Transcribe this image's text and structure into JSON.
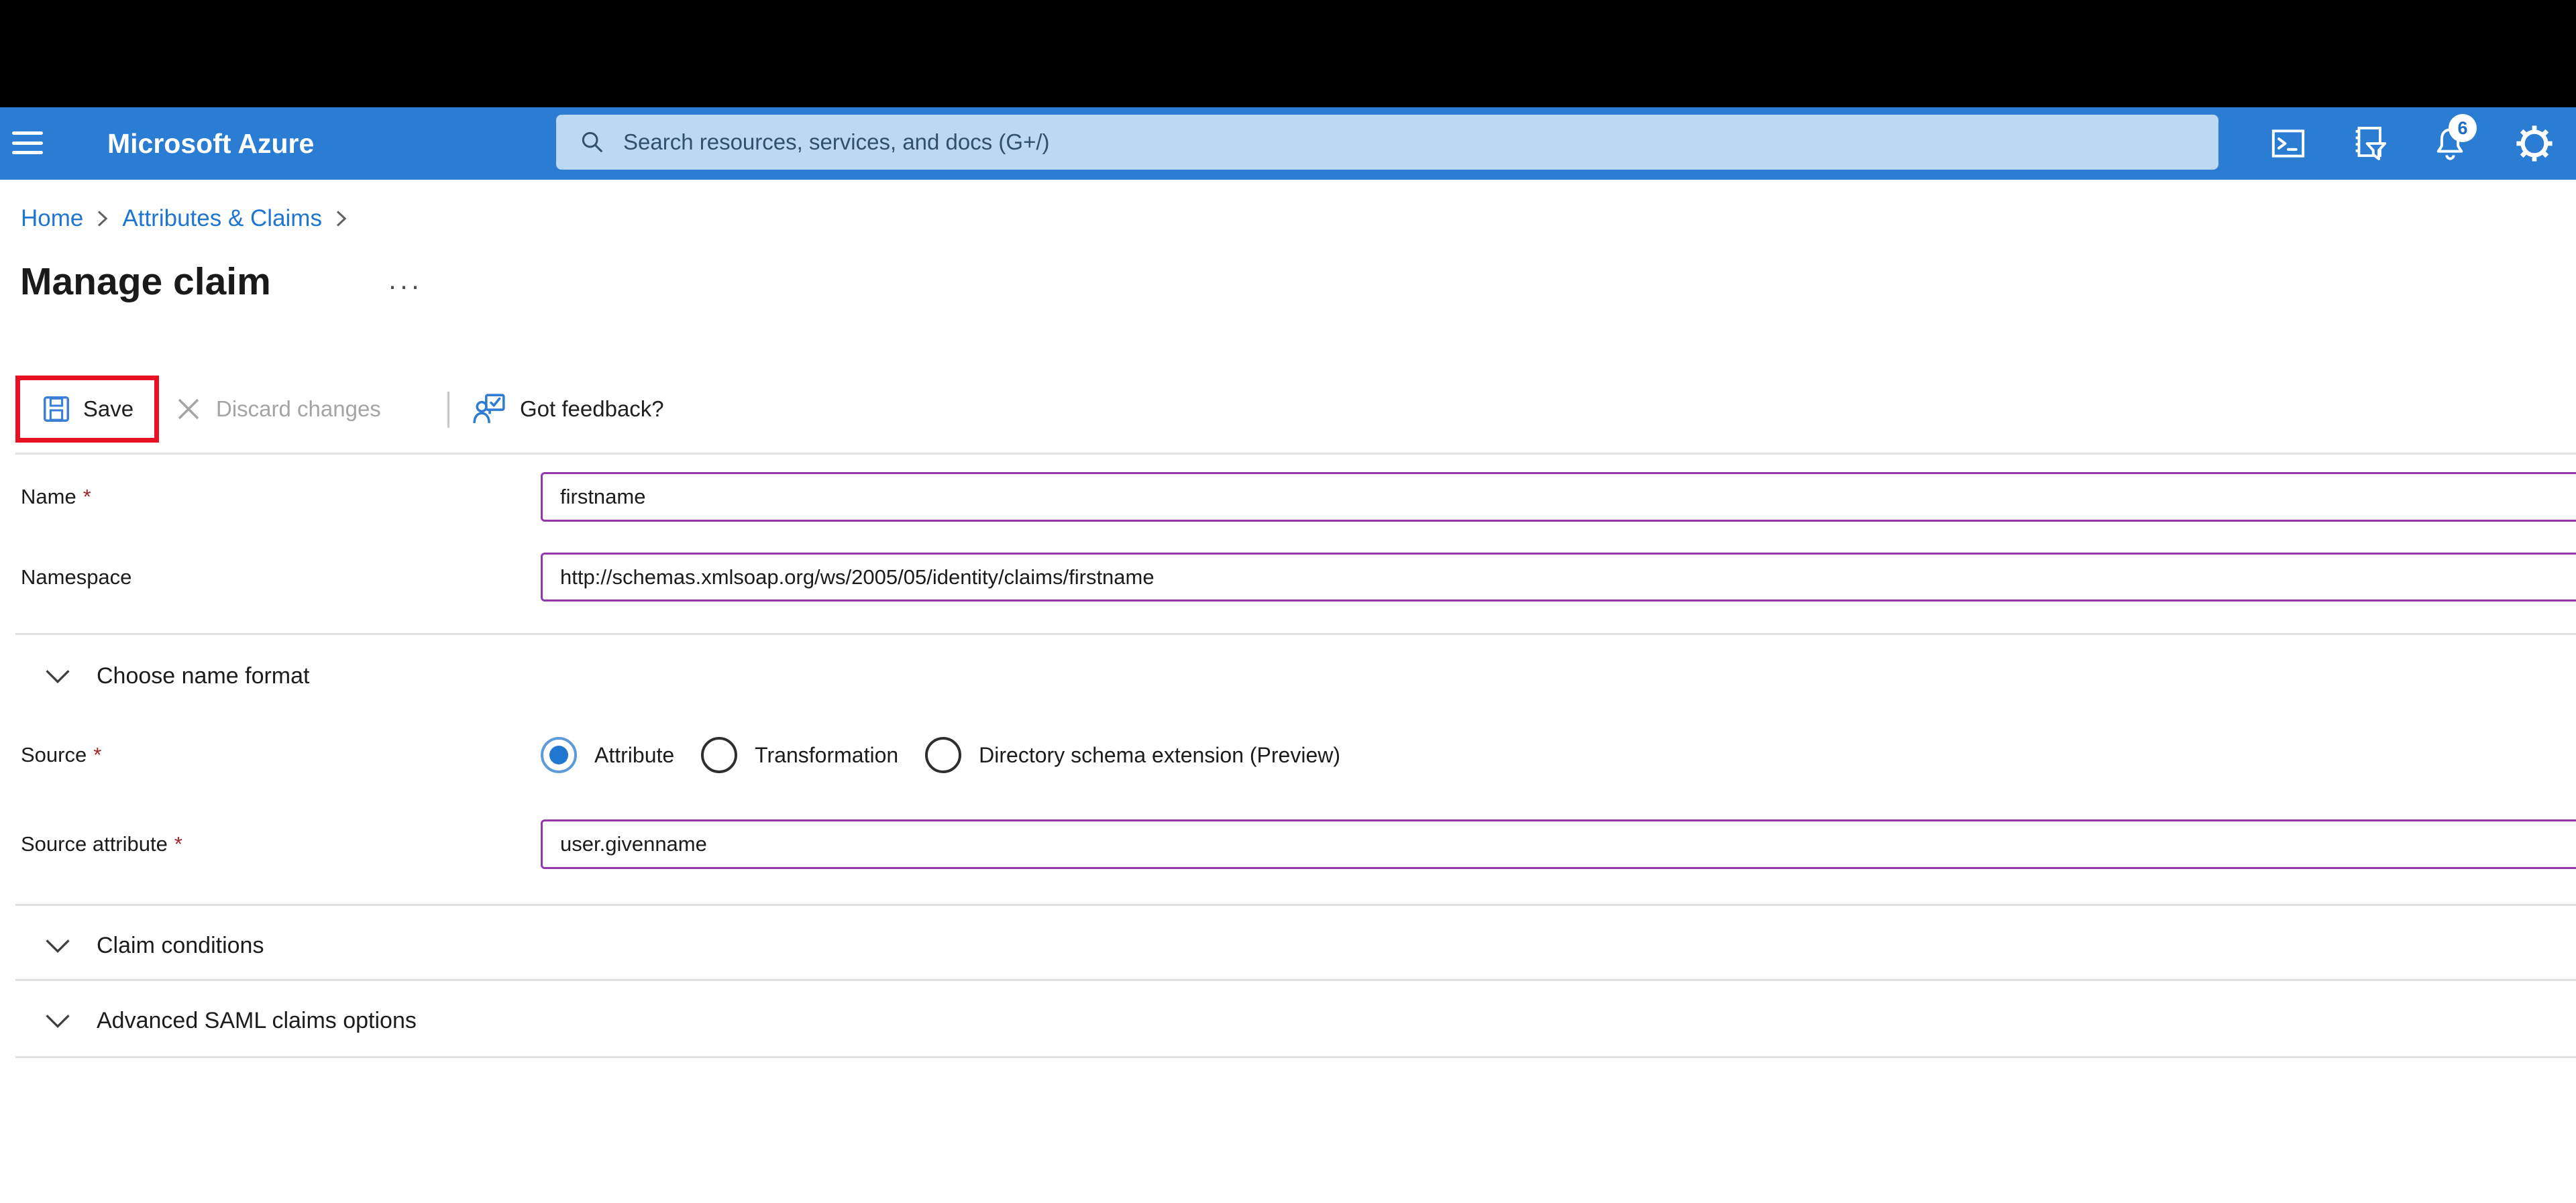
{
  "topbar": {
    "brand": "Microsoft Azure",
    "search_placeholder": "Search resources, services, and docs (G+/)",
    "notification_count": "6",
    "icons": [
      "cloud-shell-terminal",
      "directory-subscription-filter",
      "notification-bell",
      "settings-gear"
    ]
  },
  "breadcrumb": {
    "items": [
      {
        "label": "Home"
      },
      {
        "label": "Attributes & Claims"
      }
    ]
  },
  "page": {
    "title": "Manage claim",
    "more_label": "···"
  },
  "toolbar": {
    "save_label": "Save",
    "discard_label": "Discard changes",
    "feedback_label": "Got feedback?"
  },
  "form": {
    "required_marker": "*",
    "name": {
      "label": "Name",
      "value": "firstname"
    },
    "namespace": {
      "label": "Namespace",
      "value": "http://schemas.xmlsoap.org/ws/2005/05/identity/claims/firstname"
    },
    "sections": {
      "name_format": "Choose name format",
      "claim_conditions": "Claim conditions",
      "advanced_saml": "Advanced SAML claims options"
    },
    "source": {
      "label": "Source",
      "options": [
        {
          "label": "Attribute",
          "selected": true
        },
        {
          "label": "Transformation",
          "selected": false
        },
        {
          "label": "Directory schema extension (Preview)",
          "selected": false
        }
      ]
    },
    "source_attribute": {
      "label": "Source attribute",
      "value": "user.givenname"
    }
  },
  "colors": {
    "header_blue": "#2b7cd3",
    "search_bg": "#bcd9f3",
    "link_blue": "#1f76d2",
    "input_border_purple": "#9138ad",
    "highlight_red": "#e81123",
    "required_red": "#a4262c",
    "disabled_gray": "#a6a4a2"
  }
}
